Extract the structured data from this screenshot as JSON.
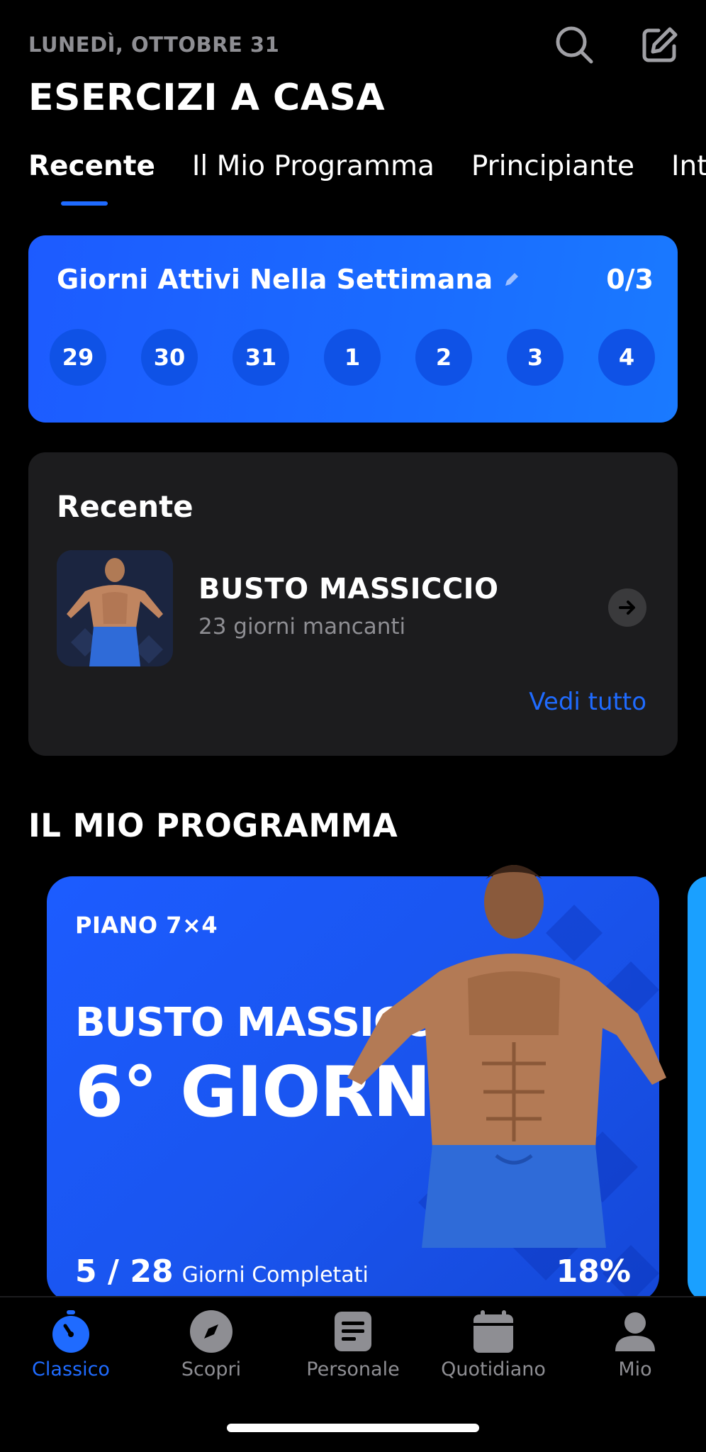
{
  "header": {
    "date": "LUNEDÌ, OTTOBRE 31",
    "title": "ESERCIZI A CASA",
    "search_icon": "search-icon",
    "edit_icon": "edit-icon"
  },
  "tabs": [
    {
      "label": "Recente",
      "active": true
    },
    {
      "label": "Il Mio Programma",
      "active": false
    },
    {
      "label": "Principiante",
      "active": false
    },
    {
      "label": "Inter",
      "active": false
    }
  ],
  "weekly": {
    "title": "Giorni Attivi Nella Settimana",
    "count": "0/3",
    "days": [
      "29",
      "30",
      "31",
      "1",
      "2",
      "3",
      "4"
    ]
  },
  "recent": {
    "heading": "Recente",
    "item_name": "BUSTO MASSICCIO",
    "item_sub": "23 giorni mancanti",
    "see_all": "Vedi tutto"
  },
  "program": {
    "section_title": "IL MIO PROGRAMMA",
    "plan_label": "PIANO 7×4",
    "name": "BUSTO MASSICCIO",
    "day": "6° GIORNO",
    "progress_done": "5 / 28",
    "progress_label": "Giorni Completati",
    "percent": "18%",
    "progress_fraction": 0.18
  },
  "tabbar": [
    {
      "label": "Classico",
      "icon": "stopwatch-icon",
      "active": true
    },
    {
      "label": "Scopri",
      "icon": "compass-icon",
      "active": false
    },
    {
      "label": "Personale",
      "icon": "document-icon",
      "active": false
    },
    {
      "label": "Quotidiano",
      "icon": "calendar-icon",
      "active": false
    },
    {
      "label": "Mio",
      "icon": "profile-icon",
      "active": false
    }
  ],
  "colors": {
    "accent": "#1f6bff",
    "background": "#000000",
    "card": "#1c1c1e",
    "muted_text": "#8e8e93"
  }
}
